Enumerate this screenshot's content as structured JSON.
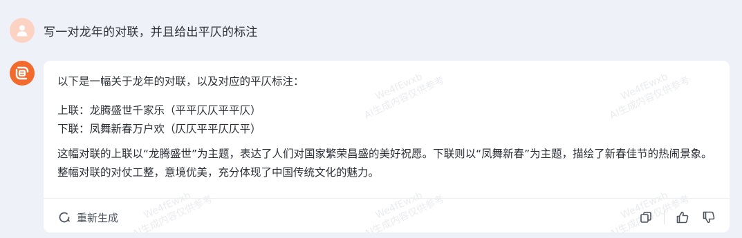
{
  "user": {
    "message": "写一对龙年的对联，并且给出平仄的标注",
    "avatar_icon": "user-icon"
  },
  "bot": {
    "avatar_icon": "bot-logo-icon",
    "intro": "以下是一幅关于龙年的对联，以及对应的平仄标注：",
    "couplet_up": "上联：龙腾盛世千家乐（平平仄仄平平仄）",
    "couplet_down": "下联：凤舞新春万户欢（仄仄平平仄仄平）",
    "explanation": "这幅对联的上联以“龙腾盛世”为主题，表达了人们对国家繁荣昌盛的美好祝愿。下联则以“凤舞新春”为主题，描绘了新春佳节的热闹景象。整幅对联的对仗工整，意境优美，充分体现了中国传统文化的魅力。"
  },
  "actions": {
    "regenerate_label": "重新生成",
    "regenerate_icon": "refresh-icon",
    "copy_icon": "copy-icon",
    "like_icon": "thumbs-up-icon",
    "dislike_icon": "thumbs-down-icon"
  },
  "watermark": {
    "line1": "We4fEwxb",
    "line2": "AI生成内容仅供参考"
  },
  "colors": {
    "background": "#eff1f8",
    "bot_avatar": "#f26b2c",
    "user_avatar": "#fcd2c2"
  }
}
